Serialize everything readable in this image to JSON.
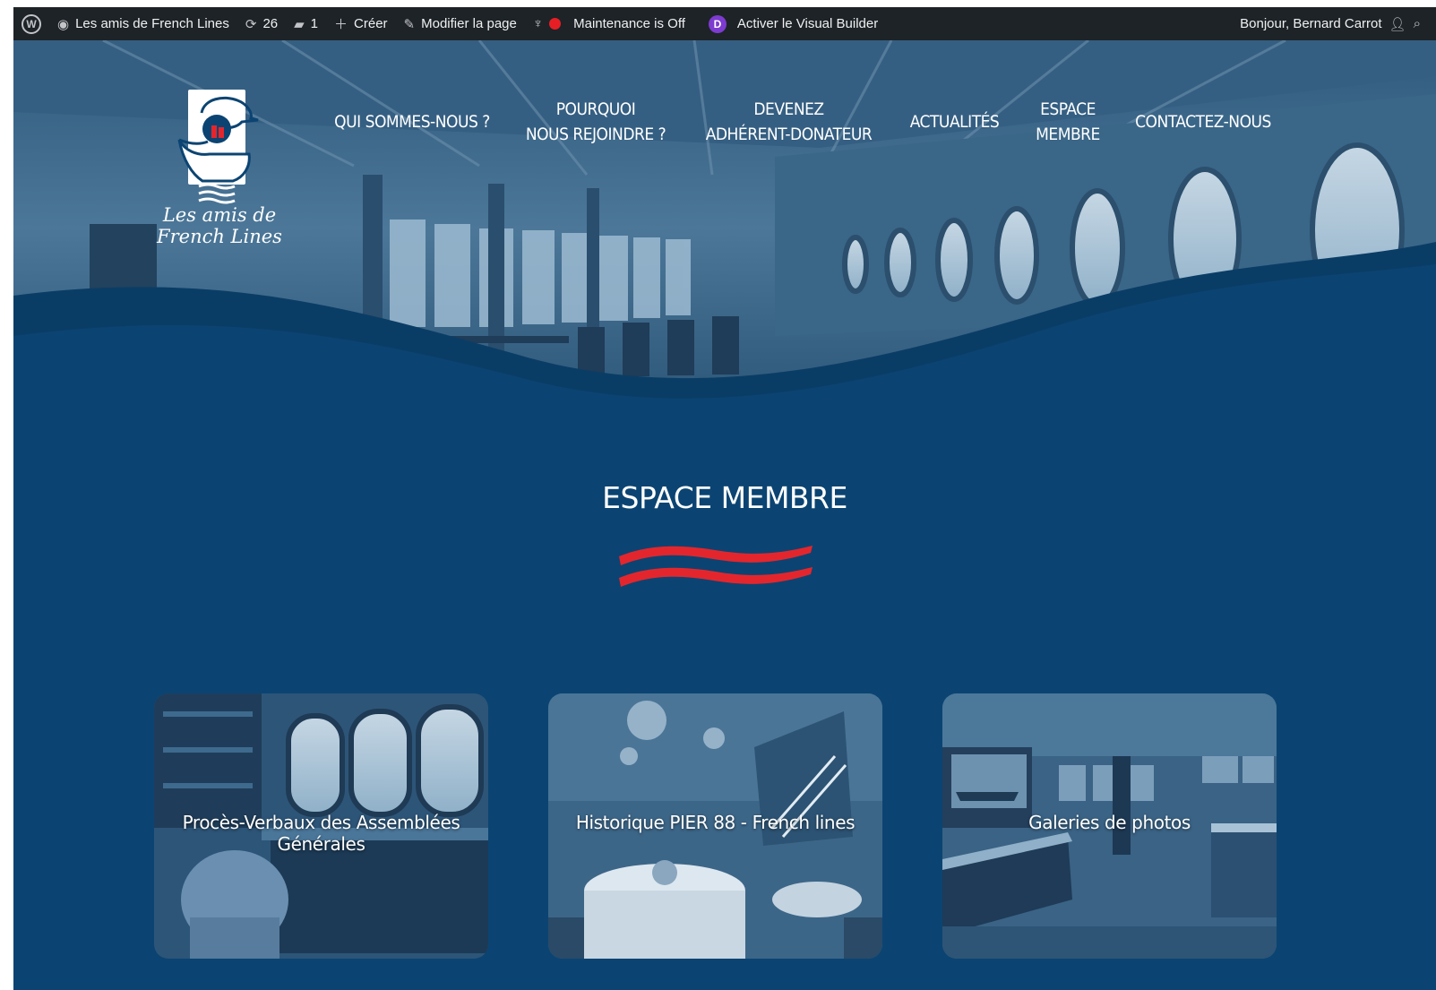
{
  "admin_bar": {
    "wp_logo": "W",
    "site_name": "Les amis de French Lines",
    "updates_count": "26",
    "comments_count": "1",
    "create_label": "Créer",
    "edit_page_label": "Modifier la page",
    "maintenance_label": "Maintenance is Off",
    "divi_letter": "D",
    "visual_builder_label": "Activer le Visual Builder",
    "greeting": "Bonjour, Bernard Carrot",
    "colors": {
      "background": "#1d2327",
      "maintenance_dot": "#e81e25",
      "divi": "#7e3bd0"
    }
  },
  "logo": {
    "line1": "Les amis de",
    "line2": "French Lines"
  },
  "nav": {
    "items": [
      {
        "label": "QUI SOMMES-NOUS ?"
      },
      {
        "label": "POURQUOI\nNOUS REJOINDRE ?"
      },
      {
        "label": "DEVENEZ\nADHÉRENT-DONATEUR"
      },
      {
        "label": "ACTUALITÉS"
      },
      {
        "label": "ESPACE\nMEMBRE"
      },
      {
        "label": "CONTACTEZ-NOUS"
      }
    ]
  },
  "main": {
    "title": "ESPACE MEMBRE",
    "cards": [
      {
        "label": "Procès-Verbaux des Assemblées Générales",
        "image": "office-with-portholes"
      },
      {
        "label": "Historique PIER 88 - French lines",
        "image": "ship-dining-room"
      },
      {
        "label": "Galeries de photos",
        "image": "museum-gallery"
      }
    ]
  },
  "colors": {
    "page_background": "#0b4472",
    "wave_dark": "#0a3d66",
    "accent_red": "#e3262d",
    "text": "#ffffff"
  }
}
